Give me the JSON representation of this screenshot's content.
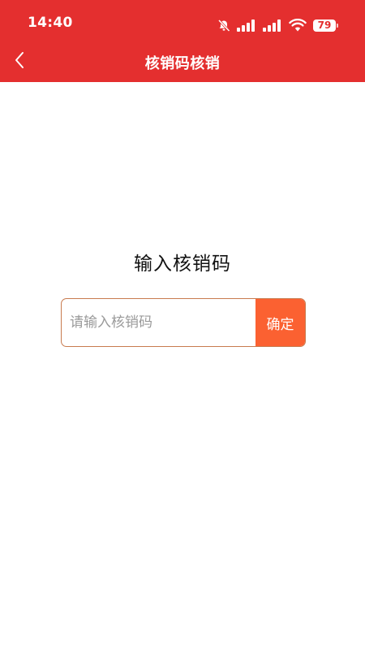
{
  "status_bar": {
    "time": "14:40",
    "battery_level": "79",
    "icons": [
      "bell-muted-icon",
      "signal-icon",
      "signal-icon",
      "wifi-icon",
      "battery-icon"
    ]
  },
  "nav": {
    "back_icon": "chevron-left-icon",
    "title": "核销码核销"
  },
  "main": {
    "heading": "输入核销码",
    "input": {
      "placeholder": "请输入核销码",
      "value": ""
    },
    "confirm_label": "确定"
  },
  "colors": {
    "header_bg": "#e42f2f",
    "button_bg": "#fb6131",
    "input_border": "#c87b4f",
    "text_on_header": "#ffffff"
  }
}
